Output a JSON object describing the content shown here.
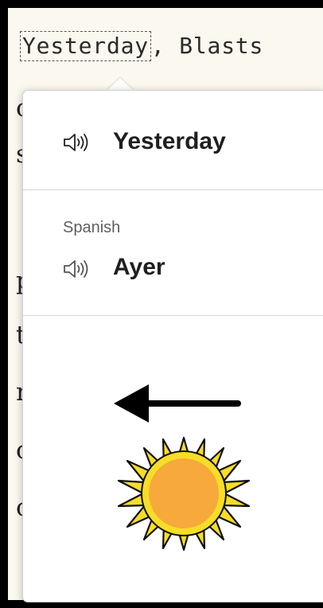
{
  "document": {
    "selected_text": "Yesterday",
    "following_text": ", Blasts"
  },
  "popup": {
    "source_word": "Yesterday",
    "target_language": "Spanish",
    "translation": "Ayer",
    "speaker_icon": "speaker-icon",
    "illustration": {
      "arrow": "left-arrow-icon",
      "sun": "sun-icon"
    }
  },
  "colors": {
    "document_background": "#fbf8ef",
    "popup_background": "#ffffff",
    "divider": "#d7d7d7",
    "sun_ray": "#f7dd27",
    "sun_core": "#f7a93b",
    "black": "#000000"
  }
}
